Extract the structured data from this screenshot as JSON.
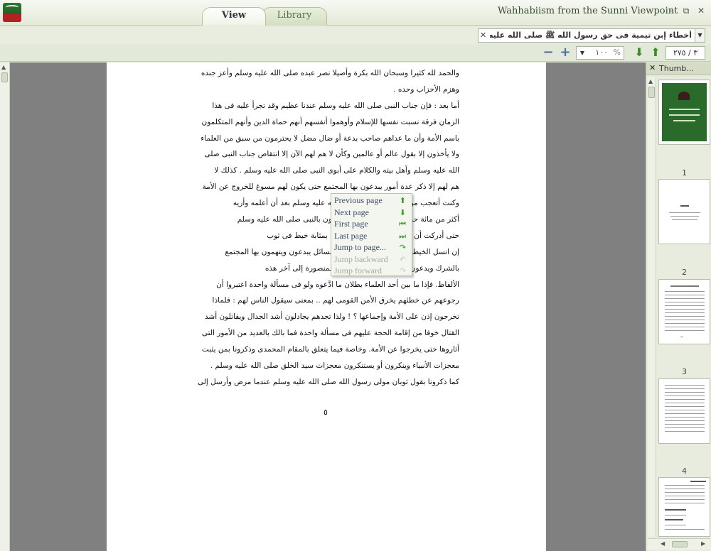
{
  "window": {
    "title": "Wahhabiism from the Sunni Viewpoint",
    "tabs": [
      {
        "label": "View",
        "active": true
      },
      {
        "label": "Library",
        "active": false
      }
    ],
    "controls": {
      "minimize": "–",
      "restore": "⧉",
      "close": "✕"
    }
  },
  "search": {
    "value": "أخطاء إبن تيمية فى حق رسول الله ﷺ صلى الله عليه و سلم و أهل بيته",
    "clear_icon": "close-icon",
    "dropdown_icon": "chevron-down-icon"
  },
  "toolbar": {
    "zoom_out": "−",
    "zoom_in": "+",
    "zoom_value": "١٠٠",
    "zoom_unit": "%",
    "next_icon": "arrow-down-icon",
    "prev_icon": "arrow-up-icon",
    "page_indicator": "٣ / ٢٧٥"
  },
  "document": {
    "lines": [
      "والحمد لله كثيرا وسبحان الله بكرة وأصيلا نصر عبده صلى الله عليه وسلم وأعز جنده",
      "وهزم الأحزاب وحده .",
      "أما بعد : فإن جناب النبى صلى الله عليه وسلم عندنا عظيم وقد تجرأ عليه فى هذا",
      "الزمان فرقة نسبت نفسها للإسلام وأوهموا أنفسهم أنهم حماة الدين وأنهم المتكلمون",
      "باسم الأمة  وأن ما عداهم صاحب بدعة أو ضال مضل لا يحترمون من سبق من العلماء",
      "ولا يأخذون إلا بقول عالم أو عالمين وكأن لا هم لهم الآن إلا انتقاص جناب النبى صلى",
      "الله عليه وسلم وأهل بيته والكلام على أبوى النبى صلى الله عليه وسلم .  كذلك لا",
      "هم لهم إلا ذكر عدة أمور  يبدعون بها المجتمع حتى يكون لهم مسوغ للخروج عن الأمة",
      "وكنت أتعجب من قولهم لأن النبى صلى الله عليه وسلم بعد أن أعلمه وأريه",
      "أكثر  من مائة  حديث من رواية الكبار  يتوسلون بالنبى صلى الله عليه وسلم",
      "حتى أدركت أن  هذه المسائل التى يجعلونها بمثابة خيط فى ثوب",
      "إن انسل الخيط  انهدم الثوب ولديهم عدة مسائل يبدعون ويتهمون بها المجتمع",
      "بالشرك ويدعون  أنهم فئة الحق والطائفة المنصورة إلى آخر هذه",
      "الألفاظ.  فإذا ما بين أحد العلماء بطلان ما ادَّعوه ولو فى مسألة واحدة اعتبروا أن",
      "رجوعهم عن خطئهم يخرق الأمن القومى لهم .. بمعنى سيقول الناس لهم : فلماذا",
      "تخرجون إذن على الأمة وإجماعها ؟ !  ولذا تجدهم يجادلون أشد الجدال ويقاتلون أشد",
      "القتال خوفا  من إقامة الحجة عليهم فى مسألة واحدة فما بالك بالعديد من الأمور التى",
      "أثاروها حتى يخرجوا عن الأمة.  وخاصة فيما يتعلق بالمقام  المحمدى وذكرونا بمن يثبت",
      "معجزات الأنبياء وينكرون أو يستنكرون معجزات سيد الخلق صلى الله عليه وسلم .",
      "كما ذكرونا بقول ثوبان مولى رسول الله صلى الله عليه وسلم عندما مرض وأرسل إلى"
    ],
    "page_number": "٥"
  },
  "context_menu": {
    "items": [
      {
        "label": "Previous page",
        "icon": "arrow-up-icon",
        "enabled": true
      },
      {
        "label": "Next page",
        "icon": "arrow-down-icon",
        "enabled": true
      },
      {
        "label": "First page",
        "icon": "first-page-icon",
        "enabled": true
      },
      {
        "label": "Last page",
        "icon": "last-page-icon",
        "enabled": true
      },
      {
        "label": "Jump to page...",
        "icon": "jump-icon",
        "enabled": true
      },
      {
        "label": "Jump backward",
        "icon": "jump-backward-icon",
        "enabled": false
      },
      {
        "label": "Jump forward",
        "icon": "jump-forward-icon",
        "enabled": false
      }
    ]
  },
  "thumbnails": {
    "title": "Thumb...",
    "pages": [
      "1",
      "2",
      "3",
      "4"
    ]
  },
  "colors": {
    "accent_green": "#3e9a2a",
    "chrome": "#e3e9d8",
    "viewer_bg": "#808080"
  }
}
